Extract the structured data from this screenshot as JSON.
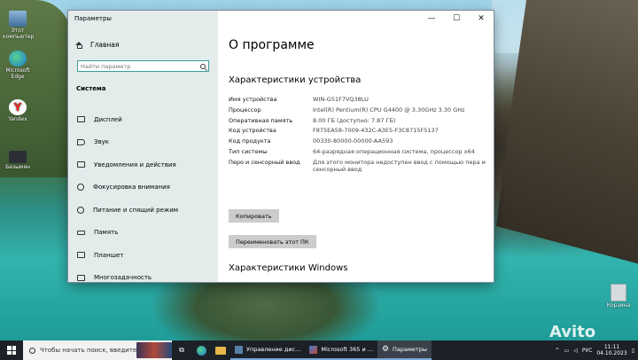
{
  "desktop": {
    "icons": [
      {
        "label": "Этот компьютер"
      },
      {
        "label": "Microsoft Edge"
      },
      {
        "label": "Yandex"
      },
      {
        "label": "Безымян"
      }
    ],
    "recycle_bin": "Корзина",
    "watermark": "Avito"
  },
  "window": {
    "title": "Параметры",
    "minimize": "—",
    "maximize": "☐",
    "close": "✕"
  },
  "nav": {
    "home": "Главная",
    "search_placeholder": "Найти параметр",
    "section": "Система",
    "items": [
      {
        "label": "Дисплей"
      },
      {
        "label": "Звук"
      },
      {
        "label": "Уведомления и действия"
      },
      {
        "label": "Фокусировка внимания"
      },
      {
        "label": "Питание и спящий режим"
      },
      {
        "label": "Память"
      },
      {
        "label": "Планшет"
      },
      {
        "label": "Многозадачность"
      }
    ]
  },
  "content": {
    "title": "О программе",
    "device_heading": "Характеристики устройства",
    "specs": [
      {
        "key": "Имя устройства",
        "value": "WIN-G51F7VQ38LU"
      },
      {
        "key": "Процессор",
        "value": "Intel(R) Pentium(R) CPU G4400 @ 3.30GHz 3.30 GHz"
      },
      {
        "key": "Оперативная память",
        "value": "8.00 ГБ (доступно: 7.87 ГБ)"
      },
      {
        "key": "Код устройства",
        "value": "F875EA58-7009-432C-A3E5-F3C8715F5137"
      },
      {
        "key": "Код продукта",
        "value": "00330-80000-00000-AA593"
      },
      {
        "key": "Тип системы",
        "value": "64-разрядная операционная система, процессор x64"
      },
      {
        "key": "Перо и сенсорный ввод",
        "value": "Для этого монитора недоступен ввод с помощью пера и сенсорный ввод"
      }
    ],
    "copy_button": "Копировать",
    "rename_button": "Переименовать этот ПК",
    "windows_heading": "Характеристики Windows"
  },
  "taskbar": {
    "search_text": "Чтобы начать поиск, введите",
    "apps": [
      {
        "label": "Управление дис...",
        "color": "#5a7fa8"
      },
      {
        "label": "Microsoft 365 и ...",
        "color": "#c24a2e"
      },
      {
        "label": "Параметры",
        "color": "#9aa4b0"
      }
    ],
    "lang": "РУС",
    "time": "11:11",
    "date": "04.10.2023"
  }
}
